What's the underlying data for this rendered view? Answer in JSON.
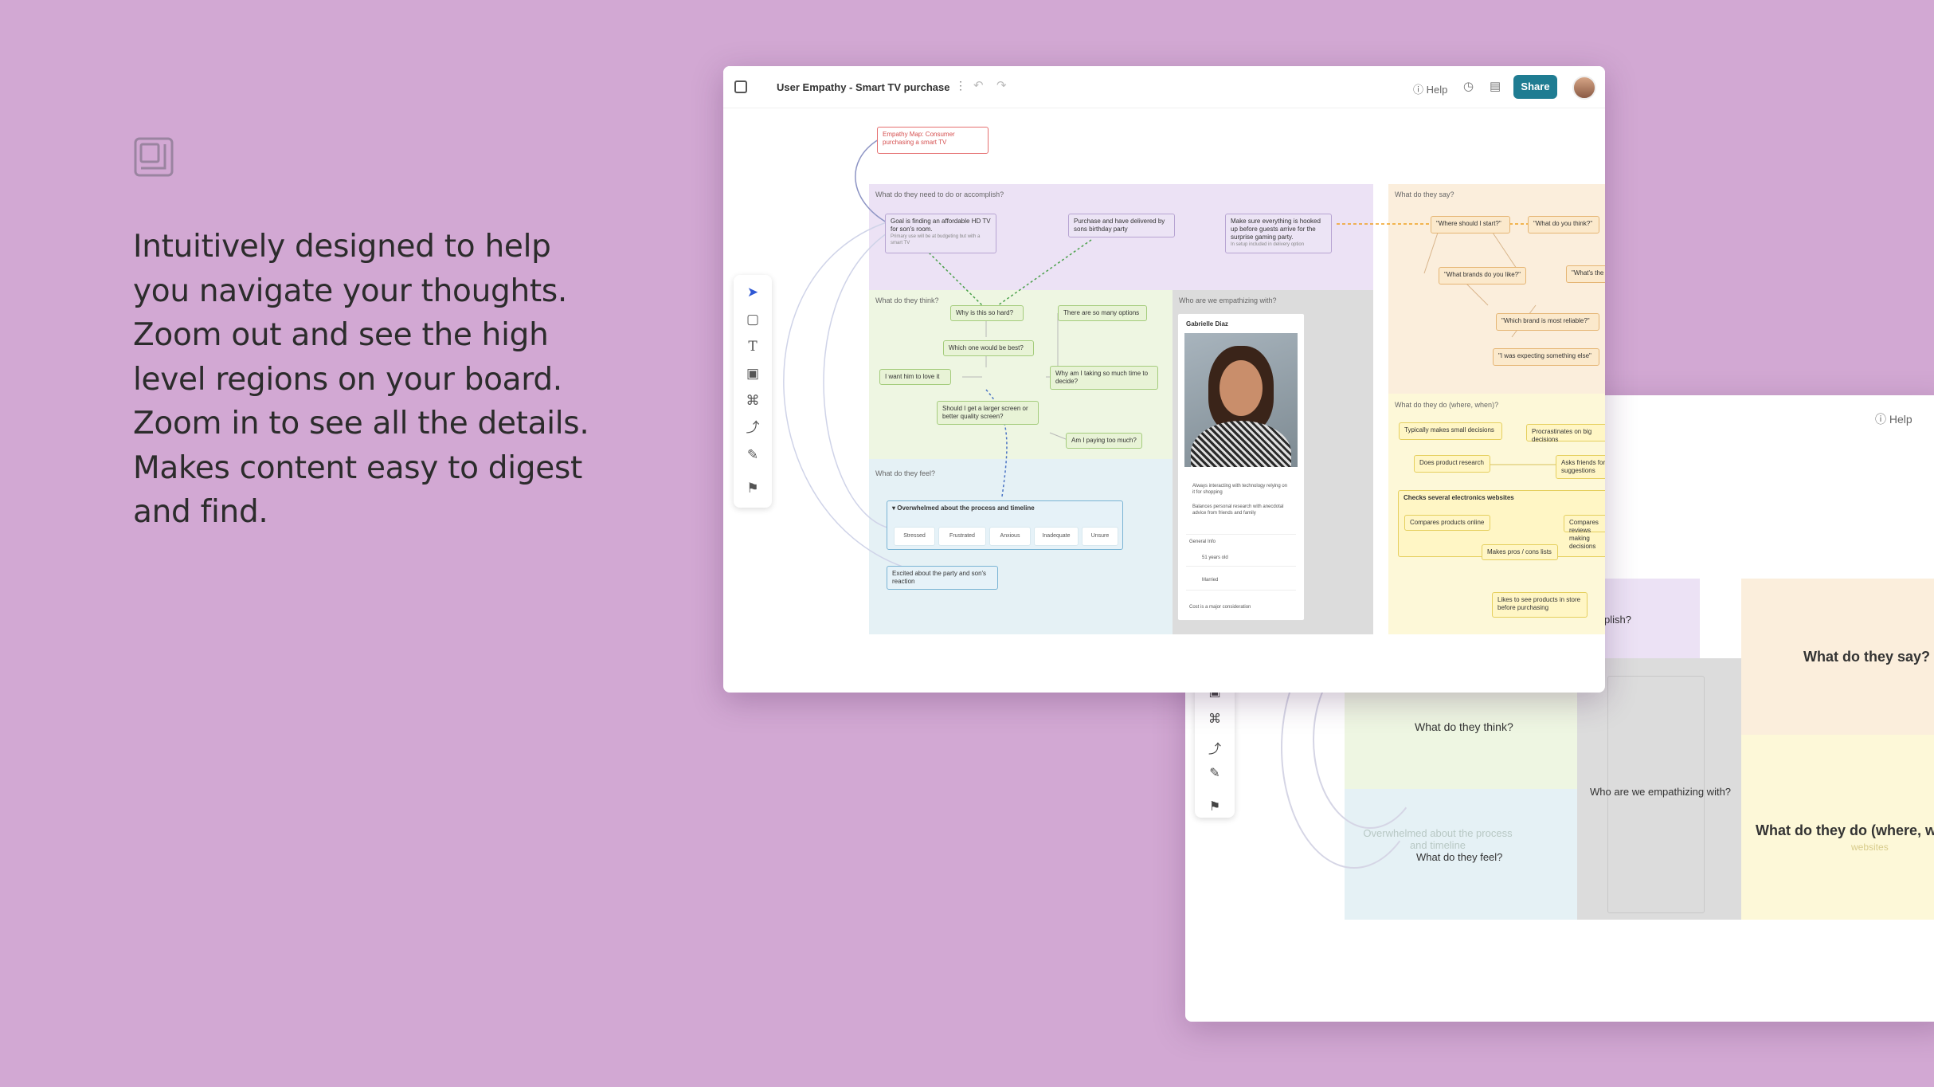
{
  "headline": {
    "lines": [
      "Intuitively designed to help",
      "you navigate your thoughts.",
      "Zoom out and see the high",
      "level regions on your board.",
      "Zoom in to see all the details.",
      "Makes content easy to digest",
      "and find."
    ]
  },
  "topbar": {
    "title": "User Empathy - Smart TV purchase",
    "help_label": "Help",
    "share_label": "Share"
  },
  "board": {
    "root_node": "Empathy Map: Consumer purchasing a smart TV",
    "regions": {
      "do_accomplish": "What do they need to do or accomplish?",
      "say": "What do they say?",
      "think": "What do they think?",
      "who": "Who are we empathizing with?",
      "feel": "What do they feel?",
      "do_where": "What do they do (where, when)?"
    },
    "accomplish_nodes": [
      "Goal is finding an affordable HD TV for son's room.",
      "Purchase and have delivered by sons birthday party",
      "Make sure everything is hooked up before guests arrive for the surprise gaming party."
    ],
    "accomplish_sub": [
      "Primary use will be at budgeting but with a smart TV",
      "In setup included in delivery option"
    ],
    "say_nodes": [
      "\"Where should I start?\"",
      "\"What do you think?\"",
      "\"What brands do you like?\"",
      "\"What's the",
      "\"Which brand is most reliable?\"",
      "\"I was expecting something else\""
    ],
    "think_nodes": [
      "Why is this so hard?",
      "There are so many options",
      "Which one would be best?",
      "I want him to love it",
      "Why am I taking so much time to decide?",
      "Should I get a larger screen or better quality screen?",
      "Am I paying too much?"
    ],
    "feel_nodes": {
      "main": "Overwhelmed about the process and timeline",
      "chips": [
        "Stressed",
        "Frustrated",
        "Anxious",
        "Inadequate",
        "Unsure"
      ],
      "other": "Excited about the party and son's reaction"
    },
    "persona": {
      "name": "Gabrielle Diaz",
      "notes": [
        "Always interacting with technology relying on it for shopping",
        "Balances personal research with anecdotal advice from friends and family"
      ],
      "section": "General Info",
      "info": [
        "51 years old",
        "Married"
      ],
      "footer": "Cost is a major consideration"
    },
    "do_nodes": [
      "Typically makes small decisions",
      "Procrastinates on big decisions",
      "Does product research",
      "Asks friends for suggestions",
      "Checks several electronics websites",
      "Compares products online",
      "Compares reviews making decisions",
      "Makes pros / cons lists",
      "Likes to see products in store before purchasing"
    ]
  },
  "zoomed_out": {
    "help_label": "Help",
    "labels": {
      "accomplish_fragment": "plish?",
      "say": "What do they say?",
      "think": "What do they think?",
      "who": "Who are we empathizing with?",
      "do_where": "What do they do (where, w",
      "feel": "What do they feel?"
    },
    "faded": {
      "feel_main": "Overwhelmed about the process and timeline",
      "do_websites": "websites"
    }
  },
  "colors": {
    "background": "#d2a8d3",
    "share": "#1f7c92",
    "accomplish_region": "#ece2f5",
    "say_region": "#fbeedc",
    "think_region": "#eef6e2",
    "who_region": "#dcdcdc",
    "feel_region": "#e5f1f5",
    "do_region": "#fdf8d8"
  }
}
